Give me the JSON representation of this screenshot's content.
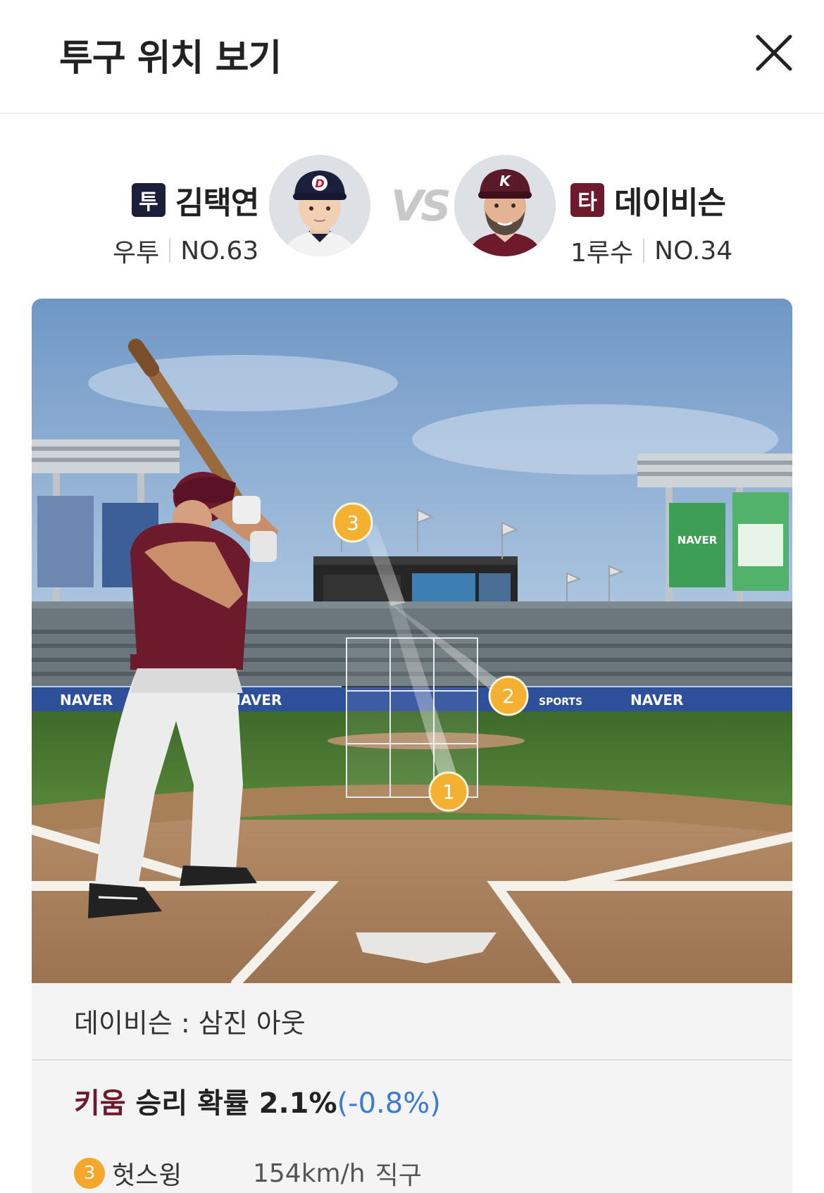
{
  "header": {
    "title": "투구 위치 보기"
  },
  "pitcher": {
    "badge": "투",
    "badge_color": "#1b1f3b",
    "name": "김택연",
    "throw": "우투",
    "number": "NO.63",
    "cap_letter": "D",
    "cap_color": "#1b1f3b"
  },
  "vs_label": "VS",
  "batter": {
    "badge": "타",
    "badge_color": "#6d1a2d",
    "name": "데이비슨",
    "position": "1루수",
    "number": "NO.34",
    "cap_letter": "K",
    "cap_color": "#5a1a28"
  },
  "field": {
    "banner_text": "NAVER",
    "banner_sub": "SPORTS",
    "pitches": [
      {
        "num": "1"
      },
      {
        "num": "2"
      },
      {
        "num": "3"
      }
    ]
  },
  "result": {
    "text": "데이비슨 : 삼진 아웃",
    "team": "키움",
    "winprob_label": "승리 확률",
    "winprob_value": "2.1%",
    "winprob_delta": "(-0.8%)"
  },
  "pitch_list": [
    {
      "num": "3",
      "result": "헛스윙",
      "speed": "154km/h",
      "type": "직구"
    }
  ]
}
